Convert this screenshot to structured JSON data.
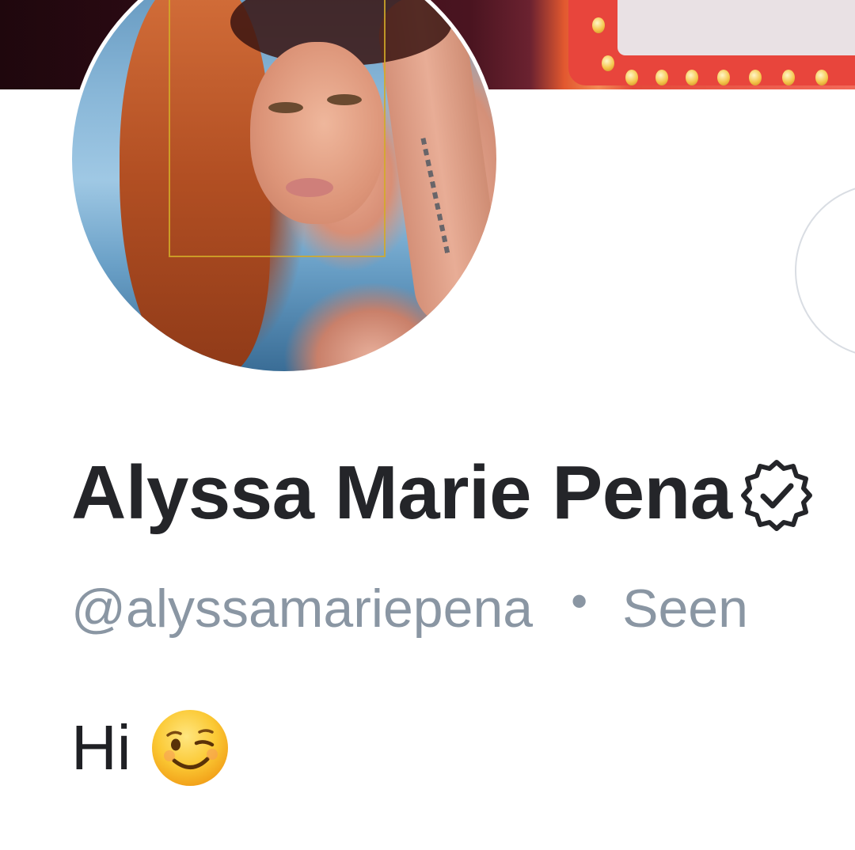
{
  "profile": {
    "display_name": "Alyssa Marie Pena",
    "handle": "@alyssamariepena",
    "separator": "•",
    "last_seen": "Seen",
    "bio_text": "Hi",
    "bio_emoji": "winking-face-emoji"
  },
  "icons": {
    "verified": "verified-badge-icon"
  },
  "colors": {
    "name": "#242529",
    "secondary": "#8a96a3",
    "background": "#ffffff"
  }
}
